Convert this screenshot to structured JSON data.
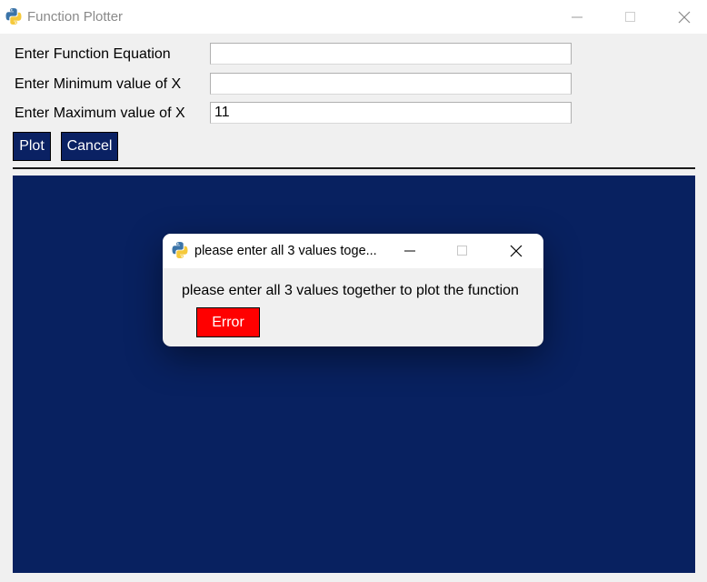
{
  "window": {
    "title": "Function Plotter"
  },
  "form": {
    "equation_label": "Enter Function Equation",
    "equation_value": "",
    "min_label": "Enter Minimum value of X",
    "min_value": "",
    "max_label": "Enter Maximum value of X",
    "max_value": "11"
  },
  "buttons": {
    "plot": "Plot",
    "cancel": "Cancel"
  },
  "dialog": {
    "title": "please enter all 3 values toge...",
    "message": "please enter all 3 values together to plot the function",
    "button": "Error"
  },
  "colors": {
    "canvas": "#082160",
    "button_bg": "#0a2163",
    "error_button": "#ff0000"
  },
  "icons": {
    "app": "python-icon",
    "minimize": "minimize-icon",
    "maximize": "maximize-icon",
    "close": "close-icon"
  }
}
